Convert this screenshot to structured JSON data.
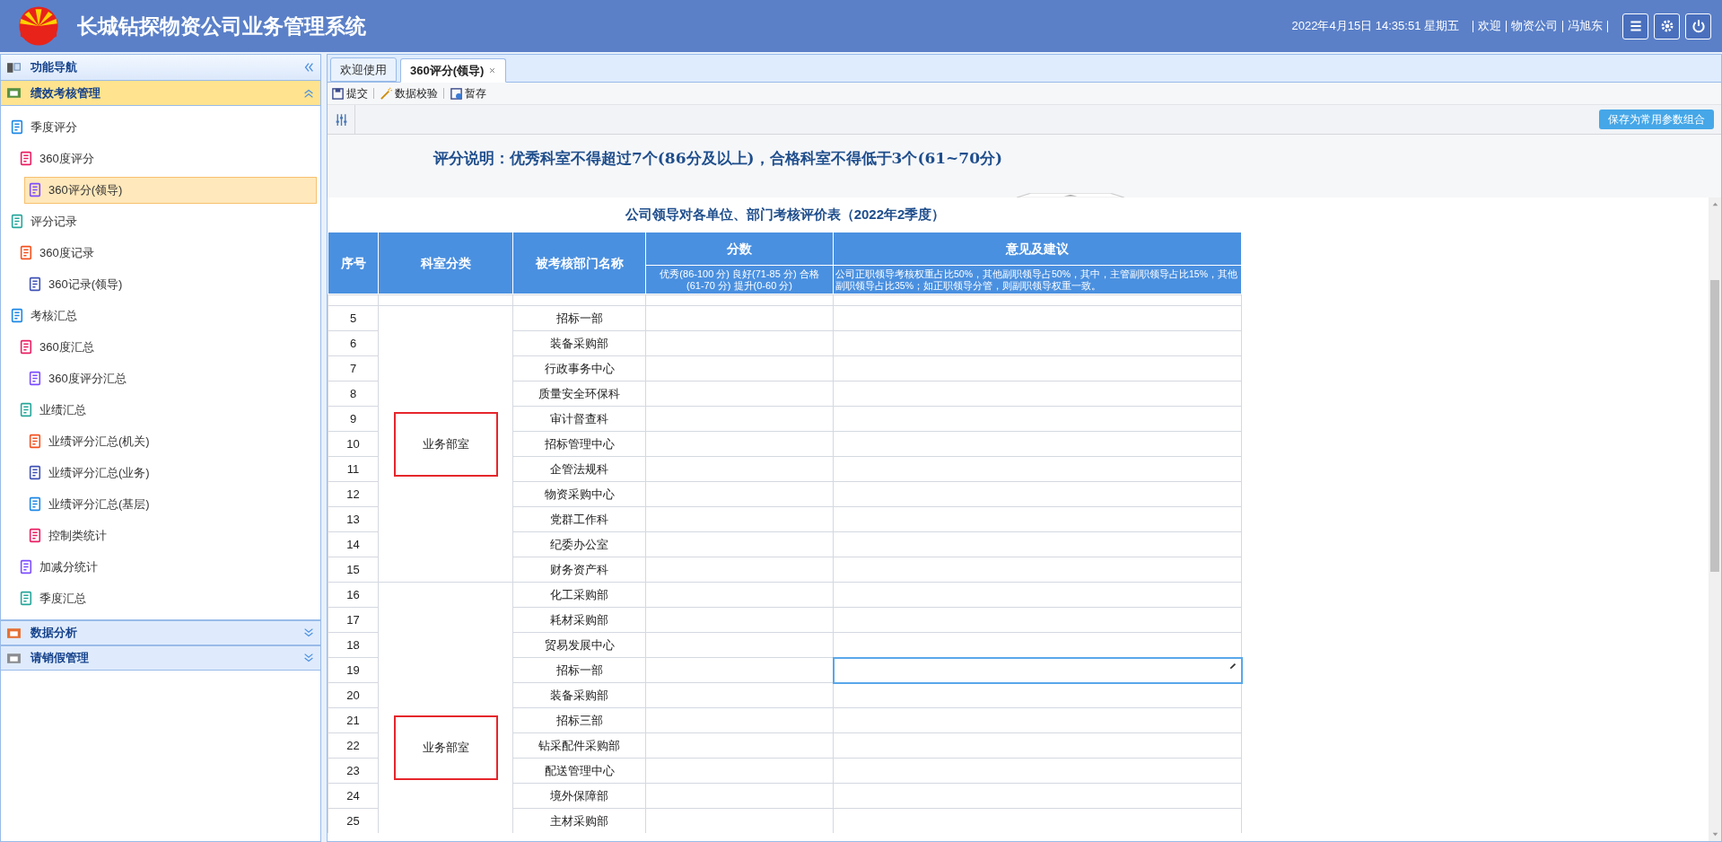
{
  "header": {
    "title": "长城钻探物资公司业务管理系统",
    "datetime": "2022年4月15日 14:35:51 星期五",
    "user_links": [
      "欢迎",
      "物资公司",
      "冯旭东"
    ]
  },
  "sidebar": {
    "title": "功能导航",
    "groups": [
      {
        "label": "绩效考核管理",
        "expanded": true,
        "items": [
          {
            "label": "季度评分",
            "selected": false,
            "children": [
              {
                "label": "360度评分",
                "selected": false,
                "children": [
                  {
                    "label": "360评分(领导)",
                    "selected": true
                  }
                ]
              }
            ]
          },
          {
            "label": "评分记录",
            "selected": false,
            "children": [
              {
                "label": "360度记录",
                "selected": false,
                "children": [
                  {
                    "label": "360记录(领导)",
                    "selected": false
                  }
                ]
              }
            ]
          },
          {
            "label": "考核汇总",
            "selected": false,
            "children": [
              {
                "label": "360度汇总",
                "selected": false,
                "children": [
                  {
                    "label": "360度评分汇总",
                    "selected": false
                  }
                ]
              },
              {
                "label": "业绩汇总",
                "selected": false,
                "children": [
                  {
                    "label": "业绩评分汇总(机关)",
                    "selected": false
                  },
                  {
                    "label": "业绩评分汇总(业务)",
                    "selected": false
                  },
                  {
                    "label": "业绩评分汇总(基层)",
                    "selected": false
                  },
                  {
                    "label": "控制类统计",
                    "selected": false
                  }
                ]
              },
              {
                "label": "加减分统计",
                "selected": false
              },
              {
                "label": "季度汇总",
                "selected": false
              }
            ]
          }
        ]
      },
      {
        "label": "数据分析",
        "expanded": false
      },
      {
        "label": "请销假管理",
        "expanded": false
      }
    ]
  },
  "tabs": [
    {
      "label": "欢迎使用",
      "selected": false,
      "closable": false
    },
    {
      "label": "360评分(领导)",
      "selected": true,
      "closable": true
    }
  ],
  "toolbar": [
    "提交",
    "数据校验",
    "暂存"
  ],
  "save_params_button": "保存为常用参数组合",
  "notice": "评分说明：优秀科室不得超过7个(86分及以上)，合格科室不得低于3个(61~70分)",
  "table": {
    "title": "公司领导对各单位、部门考核评价表（2022年2季度）",
    "columns": [
      "序号",
      "科室分类",
      "被考核部门名称",
      "分数",
      "意见及建议"
    ],
    "score_hint": "优秀(86-100 分) 良好(71-85 分) 合格(61-70 分) 提升(0-60 分)",
    "opinion_hint": "公司正职领导考核权重占比50%，其他副职领导占50%，其中，主管副职领导占比15%，其他副职领导占比35%；如正职领导分管，则副职领导权重一致。",
    "groups": [
      {
        "category": "业务部室",
        "highlighted": true,
        "rows": [
          {
            "no": "5",
            "dept": "招标一部",
            "editing": false
          },
          {
            "no": "6",
            "dept": "装备采购部",
            "editing": false
          },
          {
            "no": "7",
            "dept": "行政事务中心",
            "editing": false
          },
          {
            "no": "8",
            "dept": "质量安全环保科",
            "editing": false
          },
          {
            "no": "9",
            "dept": "审计督查科",
            "editing": false
          },
          {
            "no": "10",
            "dept": "招标管理中心",
            "editing": false
          },
          {
            "no": "11",
            "dept": "企管法规科",
            "editing": false
          },
          {
            "no": "12",
            "dept": "物资采购中心",
            "editing": false
          },
          {
            "no": "13",
            "dept": "党群工作科",
            "editing": false
          },
          {
            "no": "14",
            "dept": "纪委办公室",
            "editing": false
          },
          {
            "no": "15",
            "dept": "财务资产科",
            "editing": false
          }
        ]
      },
      {
        "category": "业务部室",
        "highlighted": true,
        "rows": [
          {
            "no": "16",
            "dept": "化工采购部",
            "editing": false
          },
          {
            "no": "17",
            "dept": "耗材采购部",
            "editing": false
          },
          {
            "no": "18",
            "dept": "贸易发展中心",
            "editing": false
          },
          {
            "no": "19",
            "dept": "招标一部",
            "editing": true
          },
          {
            "no": "20",
            "dept": "装备采购部",
            "editing": false
          },
          {
            "no": "21",
            "dept": "招标三部",
            "editing": false
          },
          {
            "no": "22",
            "dept": "钻采配件采购部",
            "editing": false
          },
          {
            "no": "23",
            "dept": "配送管理中心",
            "editing": false
          },
          {
            "no": "24",
            "dept": "境外保障部",
            "editing": false
          },
          {
            "no": "25",
            "dept": "主材采购部",
            "editing": false
          }
        ]
      }
    ]
  }
}
